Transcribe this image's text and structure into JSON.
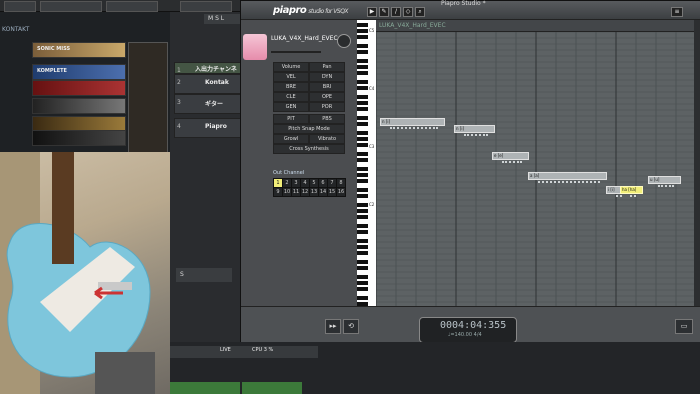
{
  "kontakt": {
    "title": "KONTAKT",
    "libraries": [
      "SONIC MISS",
      "KOMPLETE",
      "",
      "",
      "",
      ""
    ]
  },
  "daw": {
    "tracks": [
      {
        "num": "1",
        "label": "入出力チャンネル"
      },
      {
        "num": "2",
        "label": "Kontak"
      },
      {
        "num": "3",
        "label": "ギター"
      },
      {
        "num": "4",
        "label": "Piapro"
      }
    ],
    "solo_icon": "S"
  },
  "piapro": {
    "window_title": "Piapro Studio *",
    "logo": "piapro",
    "logo_sub": "studio for VSQX",
    "voice_name": "LUKA_V4X_Hard_EVEC",
    "track_name": "LUKA_V4X_Hard_EVEC",
    "params": [
      [
        "Volume",
        "Pan"
      ],
      [
        "VEL",
        "DYN"
      ],
      [
        "BRE",
        "BRI"
      ],
      [
        "CLE",
        "OPE"
      ],
      [
        "GEN",
        "POR"
      ],
      [
        "PIT",
        "PBS"
      ]
    ],
    "buttons": [
      "Pitch Snap Mode",
      "Growl",
      "Vibrato",
      "Cross Synthesis"
    ],
    "out_channel_label": "Out Channel",
    "channels": [
      "1",
      "2",
      "3",
      "4",
      "5",
      "6",
      "7",
      "8",
      "9",
      "10",
      "11",
      "12",
      "13",
      "14",
      "15",
      "16"
    ],
    "key_labels": [
      "C5",
      "C4",
      "C3",
      "C2"
    ],
    "notes": [
      {
        "text": "n [i]"
      },
      {
        "text": "n [i]"
      },
      {
        "text": "e [e]"
      },
      {
        "text": "a [a]"
      },
      {
        "text": "i [i]"
      },
      {
        "text": "ha [ha]"
      },
      {
        "text": "u [u]"
      }
    ],
    "time": "0004:04:355",
    "tempo": "♩=140.00",
    "signature": "4/4"
  },
  "bottom": {
    "live": "LIVE",
    "cpu": "CPU",
    "cpu_value": "3 %"
  },
  "colors": {
    "accent": "#f2ef7a",
    "playhead": "#d54"
  }
}
